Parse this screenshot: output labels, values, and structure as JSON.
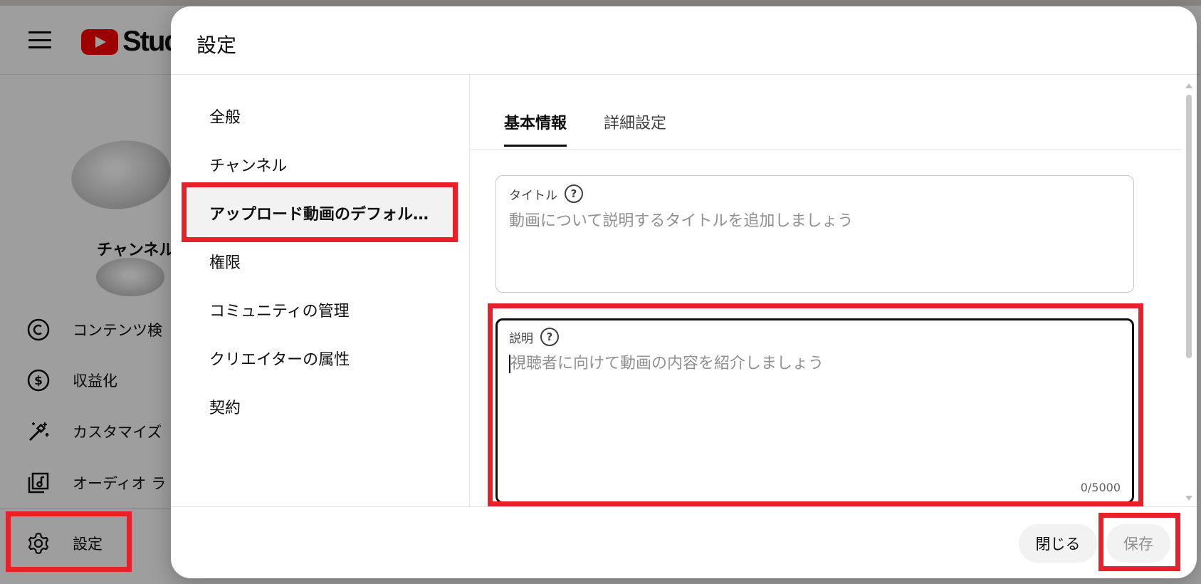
{
  "app": {
    "logo_text": "Studio",
    "channel_label": "チャンネル",
    "sidebar": [
      {
        "label": "コンテンツ検",
        "icon": "copyright-icon"
      },
      {
        "label": "収益化",
        "icon": "dollar-icon"
      },
      {
        "label": "カスタマイズ",
        "icon": "magic-wand-icon"
      },
      {
        "label": "オーディオ ラ",
        "icon": "audio-library-icon"
      },
      {
        "label": "設定",
        "icon": "gear-icon"
      }
    ]
  },
  "dialog": {
    "title": "設定",
    "nav": [
      {
        "label": "全般"
      },
      {
        "label": "チャンネル"
      },
      {
        "label": "アップロード動画のデフォル…"
      },
      {
        "label": "権限"
      },
      {
        "label": "コミュニティの管理"
      },
      {
        "label": "クリエイターの属性"
      },
      {
        "label": "契約"
      }
    ],
    "active_nav_index": 2,
    "tabs": [
      {
        "label": "基本情報"
      },
      {
        "label": "詳細設定"
      }
    ],
    "title_field": {
      "label": "タイトル",
      "placeholder": "動画について説明するタイトルを追加しましょう",
      "value": ""
    },
    "description_field": {
      "label": "説明",
      "placeholder": "視聴者に向けて動画の内容を紹介しましょう",
      "value": "",
      "counter": "0/5000"
    },
    "footer": {
      "close_label": "閉じる",
      "save_label": "保存"
    }
  },
  "colors": {
    "highlight": "#e8202a",
    "brand_red": "#ff0000"
  }
}
